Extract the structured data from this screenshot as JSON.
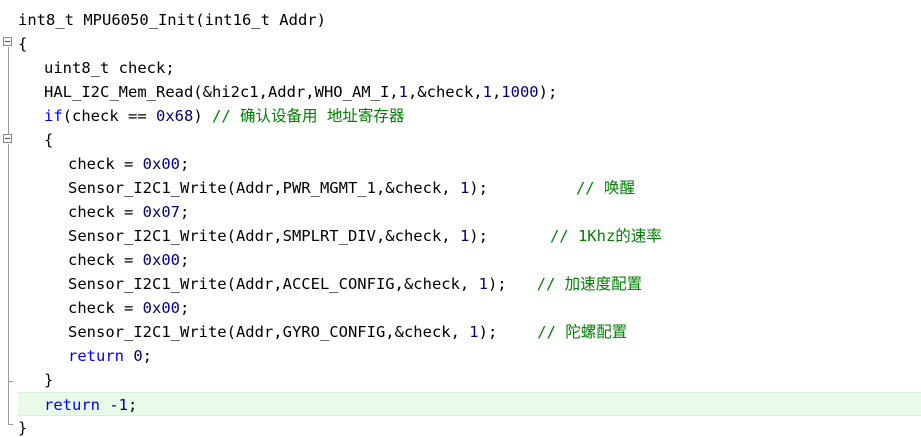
{
  "code": {
    "signature": "int8_t MPU6050_Init(int16_t Addr)",
    "open_brace": "{",
    "decl": "uint8_t check;",
    "read_call": "HAL_I2C_Mem_Read(&hi2c1,Addr,WHO_AM_I,",
    "read_arg1": "1",
    "read_mid": ",&check,",
    "read_arg2": "1",
    "read_sep": ",",
    "read_arg3": "1000",
    "read_end": ");",
    "if_kw": "if",
    "if_cond": "(check == ",
    "if_val": "0x68",
    "if_close": ") ",
    "if_comment": "// 确认设备用 地址寄存器",
    "inner_open": "{",
    "assign1": "check = ",
    "assign1_val": "0x00",
    "write1_pre": "Sensor_I2C1_Write(Addr,PWR_MGMT_1,&check, ",
    "write1_arg": "1",
    "write1_end": ");",
    "write1_comment": "// 唤醒",
    "assign2": "check = ",
    "assign2_val": "0x07",
    "write2_pre": "Sensor_I2C1_Write(Addr,SMPLRT_DIV,&check, ",
    "write2_arg": "1",
    "write2_end": ");",
    "write2_comment": "// 1Khz的速率",
    "assign3": "check = ",
    "assign3_val": "0x00",
    "write3_pre": "Sensor_I2C1_Write(Addr,ACCEL_CONFIG,&check, ",
    "write3_arg": "1",
    "write3_end": ");",
    "write3_comment": "// 加速度配置",
    "assign4": "check = ",
    "assign4_val": "0x00",
    "write4_pre": "Sensor_I2C1_Write(Addr,GYRO_CONFIG,&check, ",
    "write4_arg": "1",
    "write4_end": ");",
    "write4_comment": "// 陀螺配置",
    "return_kw": "return",
    "return0_val": " 0",
    "return0_end": ";",
    "inner_close": "}",
    "return_fail_kw": "return",
    "return_fail_val": " -1",
    "return_fail_end": ";",
    "close_brace": "}"
  },
  "colors": {
    "keyword": "#0000ff",
    "number": "#000080",
    "comment": "#008000",
    "highlight_line": "#e8fbe8"
  },
  "icons": [
    "fold-collapse-icon",
    "fold-collapse-icon"
  ]
}
